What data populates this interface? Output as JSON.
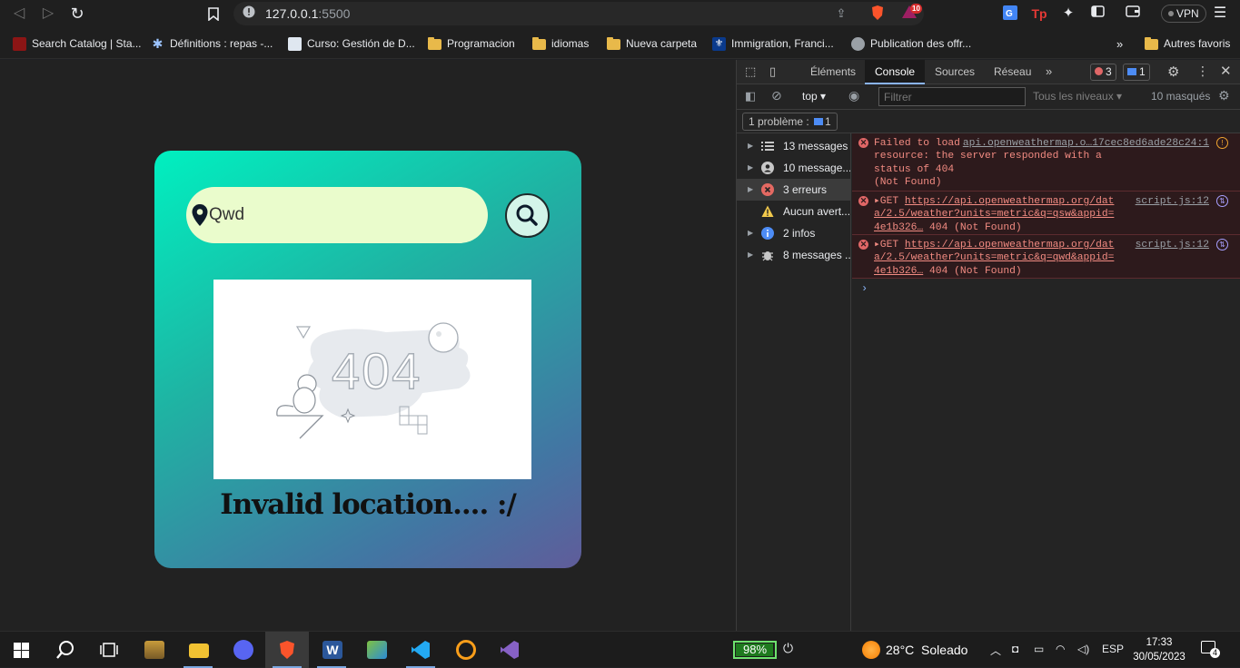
{
  "browser": {
    "url_host": "127.0.0.1",
    "url_port": ":5500",
    "vpn_label": "VPN",
    "brave_badge": "10",
    "bookmarks": [
      {
        "label": "Search Catalog | Sta...",
        "icon": "stanford-icon"
      },
      {
        "label": "Définitions : repas -...",
        "icon": "star-icon"
      },
      {
        "label": "Curso: Gestión de D...",
        "icon": "site-icon"
      },
      {
        "label": "Programacion",
        "icon": "folder-icon"
      },
      {
        "label": "idiomas",
        "icon": "folder-icon"
      },
      {
        "label": "Nueva carpeta",
        "icon": "folder-icon"
      },
      {
        "label": "Immigration, Franci...",
        "icon": "fleur-de-lis-icon"
      },
      {
        "label": "Publication des offr...",
        "icon": "globe-icon"
      }
    ],
    "more_bookmarks": "Autres favoris"
  },
  "app": {
    "search_value": "Qwd",
    "error_image_text": "404",
    "message": "Invalid location.... :/"
  },
  "devtools": {
    "tabs": [
      "Éléments",
      "Console",
      "Sources",
      "Réseau"
    ],
    "active_tab": "Console",
    "error_count": "3",
    "message_count": "1",
    "context": "top",
    "filter_placeholder": "Filtrer",
    "levels": "Tous les niveaux",
    "hidden": "10 masqués",
    "issues": "1 problème :",
    "issues_count": "1",
    "sidebar": [
      {
        "label": "13 messages",
        "icon": "list-icon"
      },
      {
        "label": "10 message...",
        "icon": "user-icon"
      },
      {
        "label": "3 erreurs",
        "icon": "error-icon"
      },
      {
        "label": "Aucun avert...",
        "icon": "warning-icon"
      },
      {
        "label": "2 infos",
        "icon": "info-icon"
      },
      {
        "label": "8 messages ...",
        "icon": "bug-icon"
      }
    ],
    "errors": [
      {
        "text": "Failed to load\nresource: the server responded with a status of 404\n(Not Found)",
        "source": "api.openweathermap.o…17cec8ed6ade28c24:1"
      },
      {
        "prefix": "▸GET ",
        "link": "https://api.openweathermap.org/data/2.5/weather?units=metric&q=qsw&appid=4e1b326…",
        "suffix": " 404 (Not Found)",
        "source": "script.js:12"
      },
      {
        "prefix": "▸GET ",
        "link": "https://api.openweathermap.org/data/2.5/weather?units=metric&q=qwd&appid=4e1b326…",
        "suffix": " 404 (Not Found)",
        "source": "script.js:12"
      }
    ]
  },
  "taskbar": {
    "battery": "98%",
    "battery_level": 0.98,
    "weather": "28°C  Soleado",
    "lang": "ESP",
    "time": "17:33",
    "date": "30/05/2023",
    "notifications": "4"
  }
}
